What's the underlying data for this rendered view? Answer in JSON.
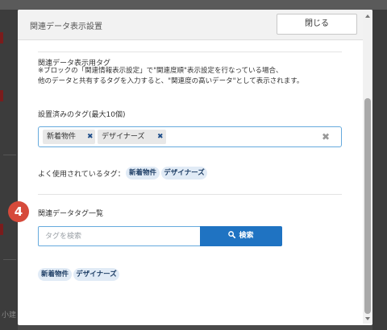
{
  "background": {
    "bottom_text": "小建"
  },
  "modal": {
    "title": "関連データ表示設置",
    "close_label": "閉じる"
  },
  "tags_section": {
    "heading": "関連データ表示用タグ",
    "desc_line1": "※ブロックの「関連情報表示設定」で\"関連度順\"表示設定を行なっている場合、",
    "desc_line2": "他のデータと共有するタグを入力すると、\"関連度の高いデータ\"として表示されます。",
    "set_tags_label": "設置済みのタグ(最大10個)",
    "set_tags": [
      "新着物件",
      "デザイナーズ"
    ],
    "frequent_label": "よく使用されているタグ：",
    "frequent_tags": [
      "新着物件",
      "デザイナーズ"
    ]
  },
  "step_badge": "4",
  "list_section": {
    "heading": "関連データタグ一覧",
    "search_placeholder": "タグを検索",
    "search_button": "検索",
    "tags": [
      "新着物件",
      "デザイナーズ"
    ]
  },
  "icons": {
    "remove": "close-icon",
    "clear": "clear-all-icon",
    "search": "search-icon"
  },
  "colors": {
    "accent": "#1f73c2",
    "badge": "#d64a3b",
    "pill_bg": "#e1ebf6"
  }
}
